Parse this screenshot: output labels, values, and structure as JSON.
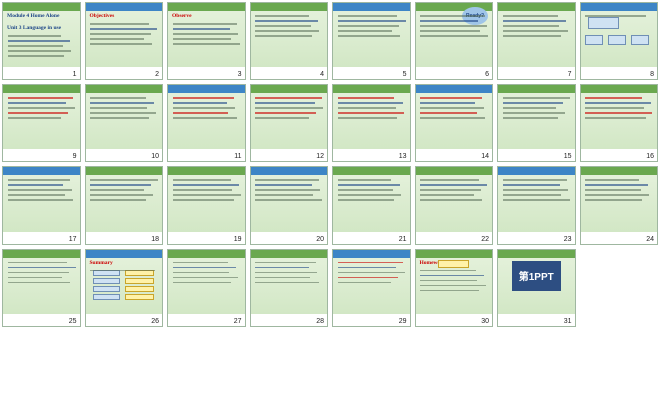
{
  "slides": [
    {
      "num": "1",
      "title": "Module 4 Home Alone",
      "subtitle": "Unit 3 Language in use",
      "kind": "cover"
    },
    {
      "num": "2",
      "title": "Objectives",
      "kind": "text"
    },
    {
      "num": "3",
      "title": "Observe",
      "kind": "text"
    },
    {
      "num": "4",
      "title": "",
      "kind": "text"
    },
    {
      "num": "5",
      "title": "",
      "kind": "text"
    },
    {
      "num": "6",
      "title": "",
      "kind": "ready",
      "badge": "Ready?"
    },
    {
      "num": "7",
      "title": "",
      "kind": "text"
    },
    {
      "num": "8",
      "title": "",
      "kind": "diagram"
    },
    {
      "num": "9",
      "title": "",
      "kind": "cn"
    },
    {
      "num": "10",
      "title": "",
      "kind": "text"
    },
    {
      "num": "11",
      "title": "",
      "kind": "cn"
    },
    {
      "num": "12",
      "title": "",
      "kind": "cn"
    },
    {
      "num": "13",
      "title": "",
      "kind": "cn"
    },
    {
      "num": "14",
      "title": "",
      "kind": "cn"
    },
    {
      "num": "15",
      "title": "",
      "kind": "text"
    },
    {
      "num": "16",
      "title": "",
      "kind": "cn"
    },
    {
      "num": "17",
      "title": "",
      "kind": "text"
    },
    {
      "num": "18",
      "title": "",
      "kind": "text"
    },
    {
      "num": "19",
      "title": "",
      "kind": "text"
    },
    {
      "num": "20",
      "title": "",
      "kind": "text"
    },
    {
      "num": "21",
      "title": "",
      "kind": "text"
    },
    {
      "num": "22",
      "title": "",
      "kind": "text"
    },
    {
      "num": "23",
      "title": "",
      "kind": "text"
    },
    {
      "num": "24",
      "title": "",
      "kind": "text"
    },
    {
      "num": "25",
      "title": "",
      "kind": "text"
    },
    {
      "num": "26",
      "title": "Summary",
      "kind": "summary"
    },
    {
      "num": "27",
      "title": "",
      "kind": "text"
    },
    {
      "num": "28",
      "title": "",
      "kind": "text"
    },
    {
      "num": "29",
      "title": "",
      "kind": "cn"
    },
    {
      "num": "30",
      "title": "Homework",
      "kind": "homework"
    },
    {
      "num": "31",
      "title": "第1PPT",
      "kind": "logo"
    }
  ]
}
